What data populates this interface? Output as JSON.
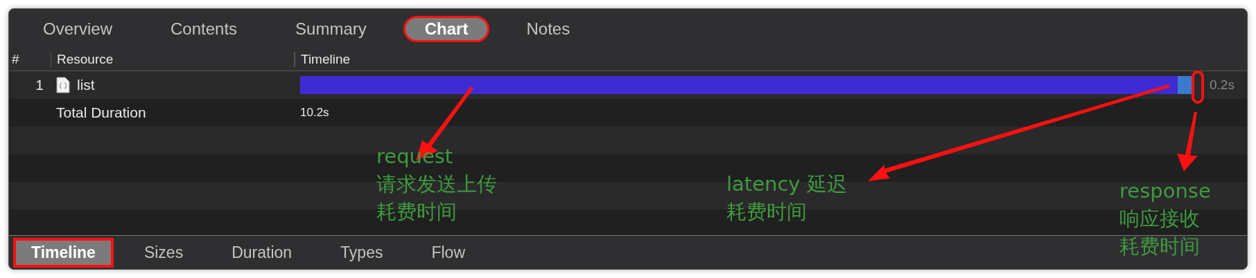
{
  "tabs": [
    {
      "label": "Overview",
      "selected": false,
      "highlighted": false
    },
    {
      "label": "Contents",
      "selected": false,
      "highlighted": false
    },
    {
      "label": "Summary",
      "selected": false,
      "highlighted": false
    },
    {
      "label": "Chart",
      "selected": true,
      "highlighted": true
    },
    {
      "label": "Notes",
      "selected": false,
      "highlighted": false
    }
  ],
  "columns": [
    "#",
    "Resource",
    "Timeline"
  ],
  "rows": [
    {
      "index": "1",
      "resource": "list",
      "segments": [
        {
          "kind": "request"
        },
        {
          "kind": "latency"
        },
        {
          "kind": "response"
        }
      ],
      "end_highlighted": true,
      "duration": "0.2s"
    },
    {
      "label": "Total Duration",
      "value": "10.2s"
    }
  ],
  "bottom_tabs": [
    {
      "label": "Timeline",
      "selected": true,
      "highlighted": true
    },
    {
      "label": "Sizes",
      "selected": false,
      "highlighted": false
    },
    {
      "label": "Duration",
      "selected": false,
      "highlighted": false
    },
    {
      "label": "Types",
      "selected": false,
      "highlighted": false
    },
    {
      "label": "Flow",
      "selected": false,
      "highlighted": false
    }
  ],
  "annotations": [
    {
      "kind": "request",
      "lines": [
        "request",
        "请求发送上传",
        "耗费时间"
      ]
    },
    {
      "kind": "latency",
      "lines": [
        "latency 延迟",
        "耗费时间"
      ]
    },
    {
      "kind": "response",
      "lines": [
        "response",
        "响应接收",
        "耗费时间"
      ]
    }
  ]
}
